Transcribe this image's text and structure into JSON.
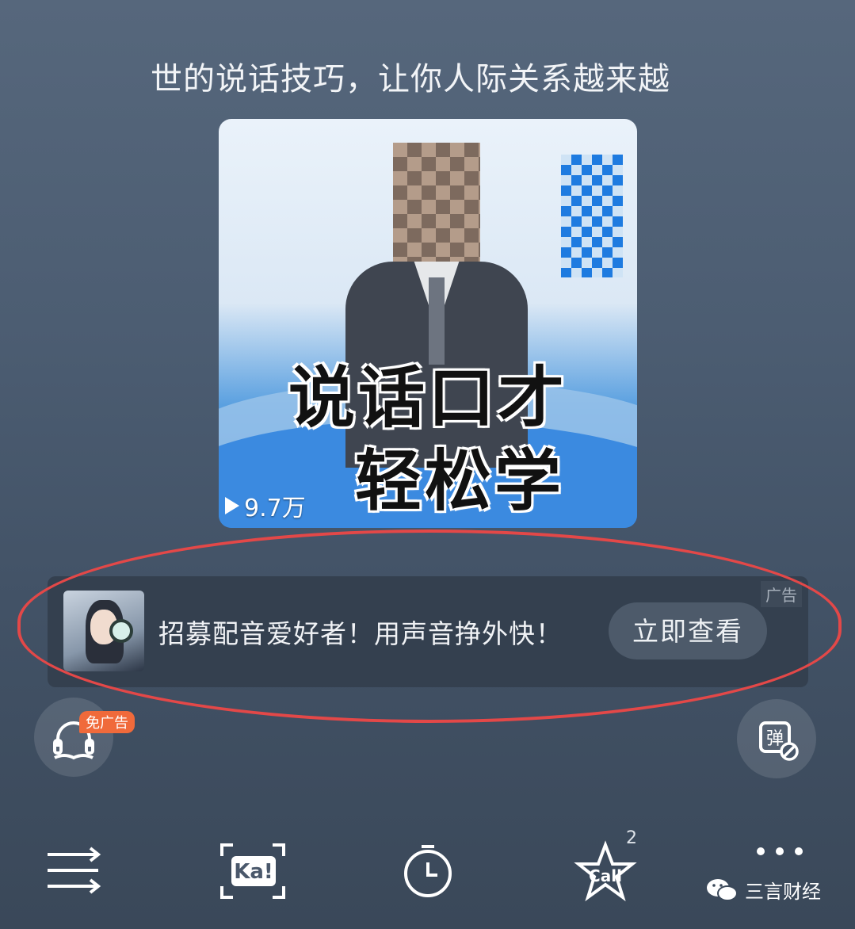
{
  "header": {
    "title": "世的说话技巧，让你人际关系越来越"
  },
  "cover": {
    "line1": "说话口才",
    "line2": "轻松学",
    "play_count": "9.7万"
  },
  "ad": {
    "tag": "广告",
    "text": "招募配音爱好者！用声音挣外快！",
    "button": "立即查看"
  },
  "controls": {
    "listen_badge": "免广告",
    "danmu_icon": "弹"
  },
  "toolbar": {
    "items": [
      {
        "icon": "playlist-icon"
      },
      {
        "icon": "ka-recognize-icon",
        "label": "Ka!"
      },
      {
        "icon": "timer-icon"
      },
      {
        "icon": "call-star-icon",
        "label": "Call",
        "count": "2"
      },
      {
        "icon": "more-icon"
      }
    ]
  },
  "watermark": {
    "text": "三言财经"
  },
  "colors": {
    "highlight": "#e34848",
    "badge": "#f06a3b",
    "cover_blue": "#2f7fd6"
  }
}
